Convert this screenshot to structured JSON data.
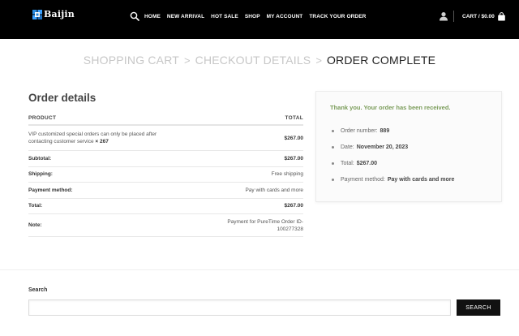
{
  "header": {
    "logo_text": "Baijin",
    "nav": [
      "HOME",
      "NEW ARRIVAL",
      "HOT SALE",
      "SHOP",
      "MY ACCOUNT",
      "TRACK YOUR ORDER"
    ],
    "cart_label": "CART / $0.00"
  },
  "steps": {
    "cart": "SHOPPING CART",
    "checkout": "CHECKOUT DETAILS",
    "complete": "ORDER COMPLETE",
    "separator": ">"
  },
  "order": {
    "title": "Order details",
    "col_product": "PRODUCT",
    "col_total": "TOTAL",
    "product_line1": "VIP customized special orders can only be placed after",
    "product_line2": "contacting customer service",
    "product_qty": "× 267",
    "product_total": "$267.00",
    "rows": [
      {
        "label": "Subtotal:",
        "value": "$267.00"
      },
      {
        "label": "Shipping:",
        "value": "Free shipping"
      },
      {
        "label": "Payment method:",
        "value": "Pay with cards and more"
      },
      {
        "label": "Total:",
        "value": "$267.00"
      }
    ],
    "note_label": "Note:",
    "note_line1": "Payment for PureTime Order ID-",
    "note_line2": "100277328"
  },
  "thanks": {
    "message": "Thank you. Your order has been received.",
    "items": [
      {
        "label": "Order number:",
        "value": "889"
      },
      {
        "label": "Date:",
        "value": "November 20, 2023"
      },
      {
        "label": "Total:",
        "value": "$267.00"
      },
      {
        "label": "Payment method:",
        "value": "Pay with cards and more"
      }
    ]
  },
  "footer": {
    "search_label": "Search",
    "search_value": "",
    "search_button": "SEARCH"
  },
  "colors": {
    "header_bg": "#000000",
    "thanks_green": "#7a9c59",
    "logo_blue": "#2a8be0"
  }
}
